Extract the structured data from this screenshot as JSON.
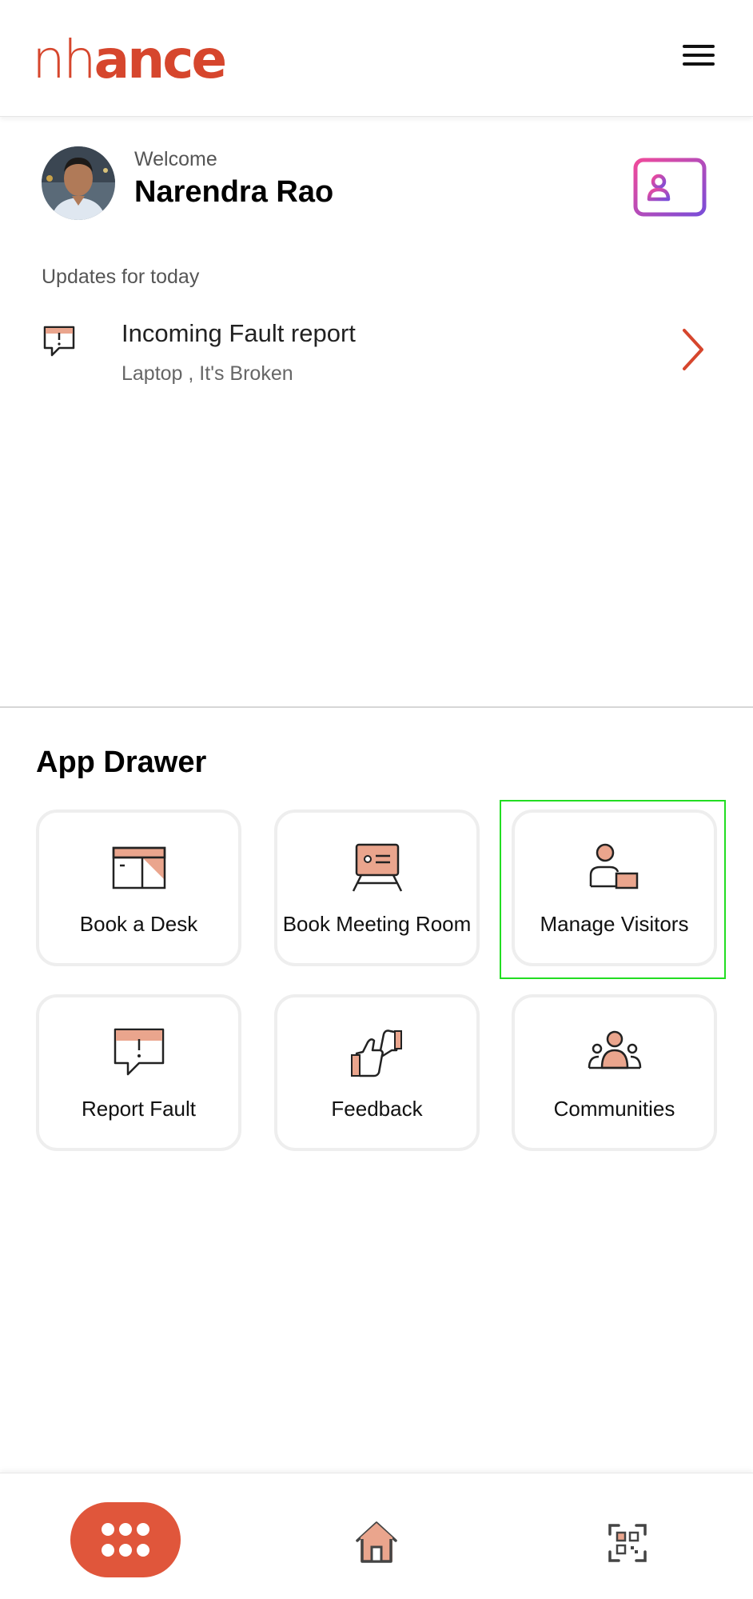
{
  "header": {
    "logo_thin": "nh",
    "logo_bold": "ance",
    "menu_icon": "hamburger-menu-icon"
  },
  "user": {
    "welcome_label": "Welcome",
    "name": "Narendra Rao",
    "id_card_icon": "id-card-icon"
  },
  "updates": {
    "label": "Updates for today",
    "items": [
      {
        "title": "Incoming Fault report",
        "subtitle": "Laptop , It's Broken",
        "icon": "fault-report-icon"
      }
    ]
  },
  "app_drawer": {
    "title": "App Drawer",
    "apps": [
      {
        "label": "Book a Desk",
        "icon": "desk-icon"
      },
      {
        "label": "Book Meeting Room",
        "icon": "meeting-room-icon"
      },
      {
        "label": "Manage Visitors",
        "icon": "visitors-icon"
      },
      {
        "label": "Report Fault",
        "icon": "report-fault-icon"
      },
      {
        "label": "Feedback",
        "icon": "feedback-icon"
      },
      {
        "label": "Communities",
        "icon": "communities-icon"
      }
    ]
  },
  "bottom_nav": {
    "items": [
      "apps-grid-icon",
      "home-icon",
      "qr-scan-icon"
    ]
  },
  "colors": {
    "brand": "#d6462d",
    "accent_fill": "#eaa58d",
    "nav_active": "#e0563b",
    "tile_border": "#eeeeee",
    "highlight": "#22dd22"
  }
}
